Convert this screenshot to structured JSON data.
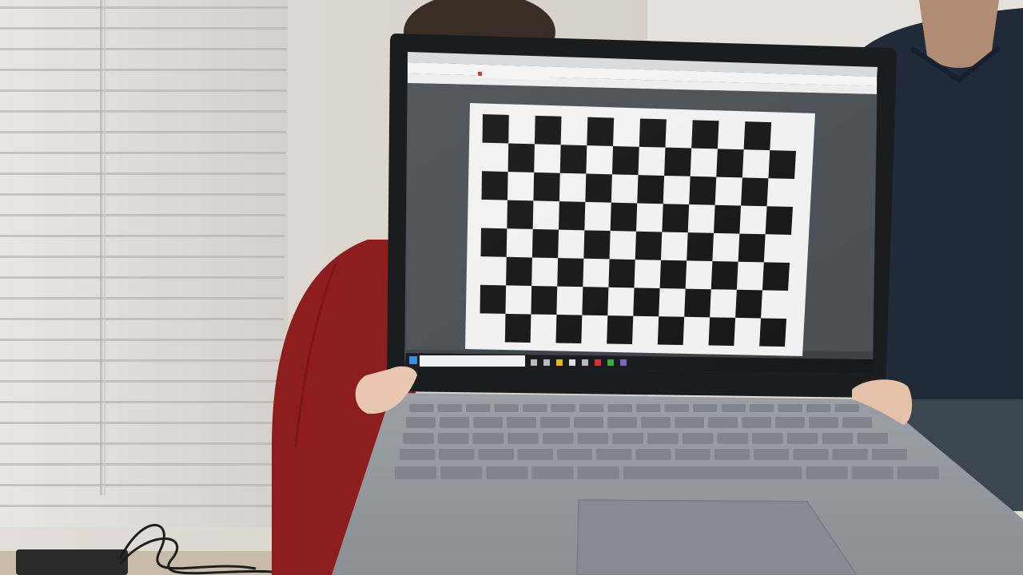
{
  "scene": {
    "description_kind": "photo",
    "board": {
      "columns": 12,
      "rows": 8
    }
  },
  "browser": {
    "tab_label": "",
    "address": "",
    "bookmarks": []
  },
  "taskbar": {
    "search_placeholder": "",
    "clock": ""
  }
}
